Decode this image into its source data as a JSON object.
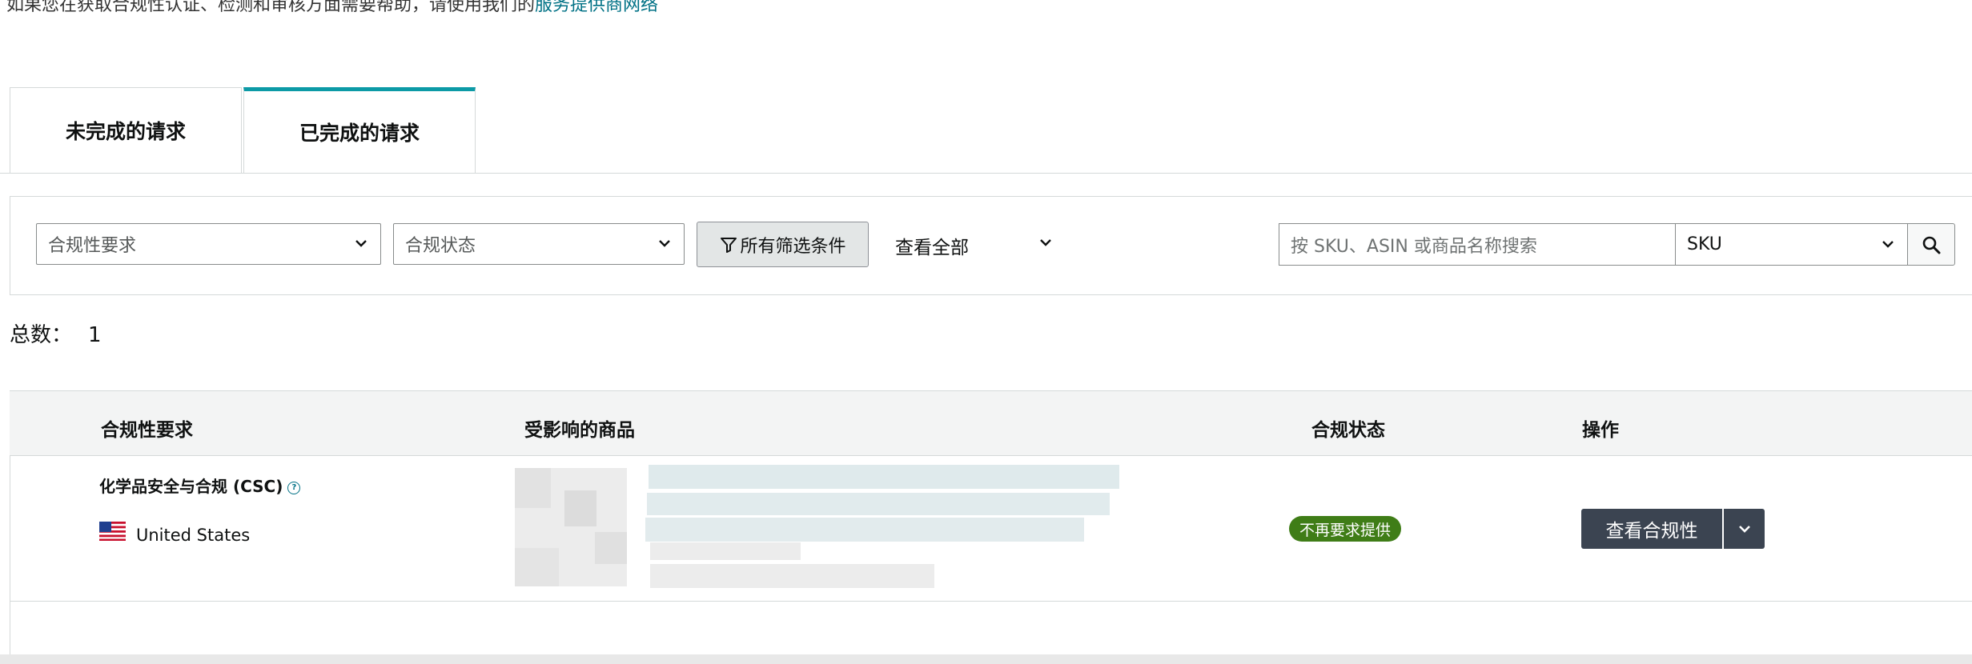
{
  "help": {
    "text": "如果您在获取合规性认证、检测和审核方面需要帮助，请使用我们的",
    "link": "服务提供商网络"
  },
  "tabs": [
    {
      "label": "未完成的请求",
      "active": false
    },
    {
      "label": "已完成的请求",
      "active": true
    }
  ],
  "filters": {
    "requirement_placeholder": "合规性要求",
    "status_placeholder": "合规状态",
    "all_filters_label": "所有筛选条件",
    "view_all_label": "查看全部",
    "search_placeholder": "按 SKU、ASIN 或商品名称搜索",
    "search_type": "SKU"
  },
  "total": {
    "label": "总数：",
    "count": "1"
  },
  "table": {
    "headers": [
      "合规性要求",
      "受影响的商品",
      "合规状态",
      "操作"
    ],
    "rows": [
      {
        "requirement": "化学品安全与合规 (CSC)",
        "info_icon": "?",
        "country": "United States",
        "status": "不再要求提供",
        "status_color": "#3f7d17",
        "action": "查看合规性"
      }
    ]
  },
  "colors": {
    "accent": "#0c9aa6",
    "link": "#007185",
    "action": "#3b4451"
  }
}
